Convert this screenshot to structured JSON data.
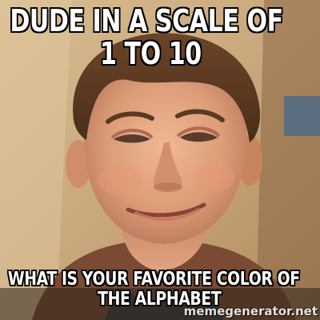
{
  "meme": {
    "top_text": {
      "line1": "DUDE IN A SCALE OF",
      "line2": "1 TO 10"
    },
    "bottom_text": {
      "line1": "WHAT IS YOUR FAVORITE COLOR OF",
      "line2": "THE ALPHABET"
    },
    "watermark": "memegenerator.net"
  },
  "colors": {
    "caption_fill": "#ffffff",
    "caption_outline": "#000000",
    "background_wall": "#c9a77c",
    "skin_tone": "#dba07c",
    "hair": "#5a3a22",
    "shirt": "#3a3a3a"
  }
}
